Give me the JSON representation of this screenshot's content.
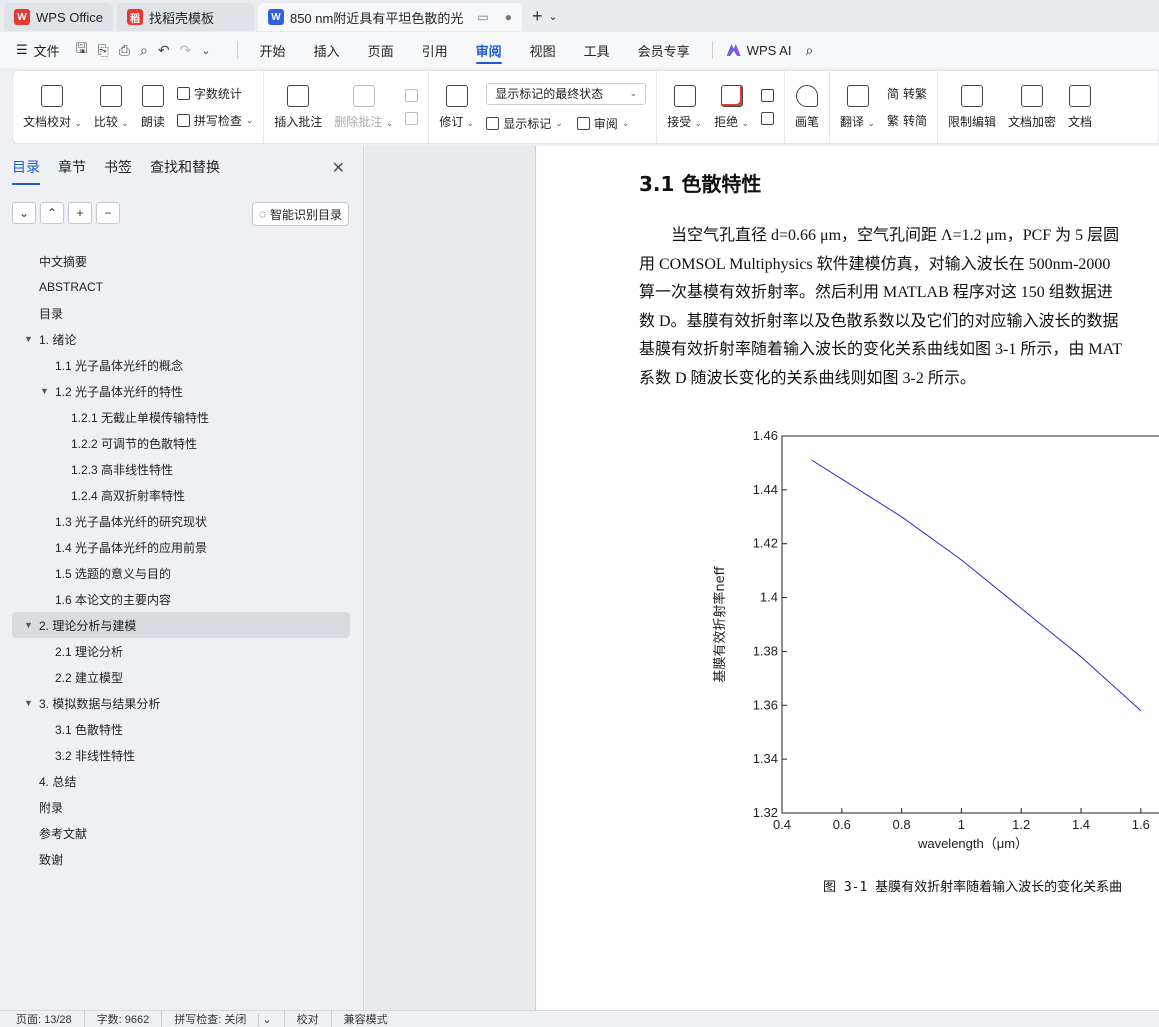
{
  "tabs": [
    {
      "label": "WPS Office",
      "logo": "W",
      "color": "#e53935",
      "state": "inactive"
    },
    {
      "label": "找稻壳模板",
      "logo": "稻",
      "color": "#e53935",
      "state": "inactive"
    },
    {
      "label": "850 nm附近具有平坦色散的光",
      "logo": "W",
      "color": "#2f5fe0",
      "state": "active"
    }
  ],
  "menubar": {
    "file_label": "文件",
    "items": [
      "开始",
      "插入",
      "页面",
      "引用",
      "审阅",
      "视图",
      "工具",
      "会员专享"
    ],
    "active": "审阅",
    "ai_label": "WPS AI"
  },
  "ribbon": {
    "doc_check": "文档校对",
    "compare": "比较",
    "read_aloud": "朗读",
    "word_count": "字数统计",
    "spell_check": "拼写检查",
    "insert_comment": "插入批注",
    "delete_comment": "删除批注",
    "revise": "修订",
    "markup_state": "显示标记的最终状态",
    "show_markup": "显示标记",
    "review": "审阅",
    "accept": "接受",
    "reject": "拒绝",
    "pen": "画笔",
    "translate": "翻译",
    "to_traditional": "转繁",
    "to_simplified": "转简",
    "restrict_edit": "限制编辑",
    "encrypt": "文档加密",
    "doc_more": "文档"
  },
  "sidebar": {
    "tabs": [
      "目录",
      "章节",
      "书签",
      "查找和替换"
    ],
    "smart_label": "智能识别目录",
    "toc": [
      {
        "text": "中文摘要",
        "level": 1,
        "arrow": ""
      },
      {
        "text": "ABSTRACT",
        "level": 1,
        "arrow": ""
      },
      {
        "text": "目录",
        "level": 1,
        "arrow": ""
      },
      {
        "text": "1. 绪论",
        "level": 1,
        "arrow": "▼"
      },
      {
        "text": "1.1  光子晶体光纤的概念",
        "level": 2,
        "arrow": ""
      },
      {
        "text": "1.2  光子晶体光纤的特性",
        "level": 2,
        "arrow": "▼"
      },
      {
        "text": "1.2.1  无截止单模传输特性",
        "level": 3,
        "arrow": ""
      },
      {
        "text": "1.2.2  可调节的色散特性",
        "level": 3,
        "arrow": ""
      },
      {
        "text": "1.2.3  高非线性特性",
        "level": 3,
        "arrow": ""
      },
      {
        "text": "1.2.4  高双折射率特性",
        "level": 3,
        "arrow": ""
      },
      {
        "text": "1.3  光子晶体光纤的研究现状",
        "level": 2,
        "arrow": ""
      },
      {
        "text": "1.4  光子晶体光纤的应用前景",
        "level": 2,
        "arrow": ""
      },
      {
        "text": "1.5  选题的意义与目的",
        "level": 2,
        "arrow": ""
      },
      {
        "text": "1.6  本论文的主要内容",
        "level": 2,
        "arrow": ""
      },
      {
        "text": "2. 理论分析与建模",
        "level": 1,
        "arrow": "▼",
        "selected": true
      },
      {
        "text": "2.1  理论分析",
        "level": 2,
        "arrow": ""
      },
      {
        "text": "2.2  建立模型",
        "level": 2,
        "arrow": ""
      },
      {
        "text": "3. 模拟数据与结果分析",
        "level": 1,
        "arrow": "▼"
      },
      {
        "text": "3.1  色散特性",
        "level": 2,
        "arrow": ""
      },
      {
        "text": "3.2  非线性特性",
        "level": 2,
        "arrow": ""
      },
      {
        "text": "4. 总结",
        "level": 1,
        "arrow": ""
      },
      {
        "text": "附录",
        "level": 1,
        "arrow": ""
      },
      {
        "text": "参考文献",
        "level": 1,
        "arrow": ""
      },
      {
        "text": "致谢",
        "level": 1,
        "arrow": ""
      }
    ]
  },
  "document": {
    "heading": "3.1  色散特性",
    "paragraph_lines": [
      "当空气孔直径 d=0.66 μm，空气孔间距 Λ=1.2 μm，PCF 为 5 层圆",
      "用 COMSOL Multiphysics 软件建模仿真，对输入波长在 500nm-2000",
      "算一次基模有效折射率。然后利用 MATLAB 程序对这 150 组数据进",
      "数 D。基膜有效折射率以及色散系数以及它们的对应输入波长的数据",
      "基膜有效折射率随着输入波长的变化关系曲线如图 3-1 所示，由 MAT",
      "系数 D 随波长变化的关系曲线则如图 3-2 所示。"
    ],
    "caption": "图 3-1  基膜有效折射率随着输入波长的变化关系曲"
  },
  "chart_data": {
    "type": "line",
    "xlabel": "wavelength（μm）",
    "ylabel": "基膜有效折射率neff",
    "xlim": [
      0.4,
      1.6
    ],
    "ylim": [
      1.32,
      1.46
    ],
    "x_ticks": [
      "0.4",
      "0.6",
      "0.8",
      "1",
      "1.2",
      "1.4",
      "1.6"
    ],
    "y_ticks": [
      "1.46",
      "1.44",
      "1.42",
      "1.4",
      "1.38",
      "1.36",
      "1.34",
      "1.32"
    ],
    "series": [
      {
        "x": [
          0.5,
          0.6,
          0.8,
          1.0,
          1.2,
          1.4,
          1.6
        ],
        "y": [
          1.451,
          1.444,
          1.43,
          1.414,
          1.396,
          1.378,
          1.358
        ],
        "color": "#2b2bcf"
      }
    ]
  },
  "statusbar": {
    "page": "页面: 13/28",
    "words": "字数: 9662",
    "spell": "拼写检查: 关闭",
    "proof": "校对",
    "compat": "兼容模式"
  }
}
